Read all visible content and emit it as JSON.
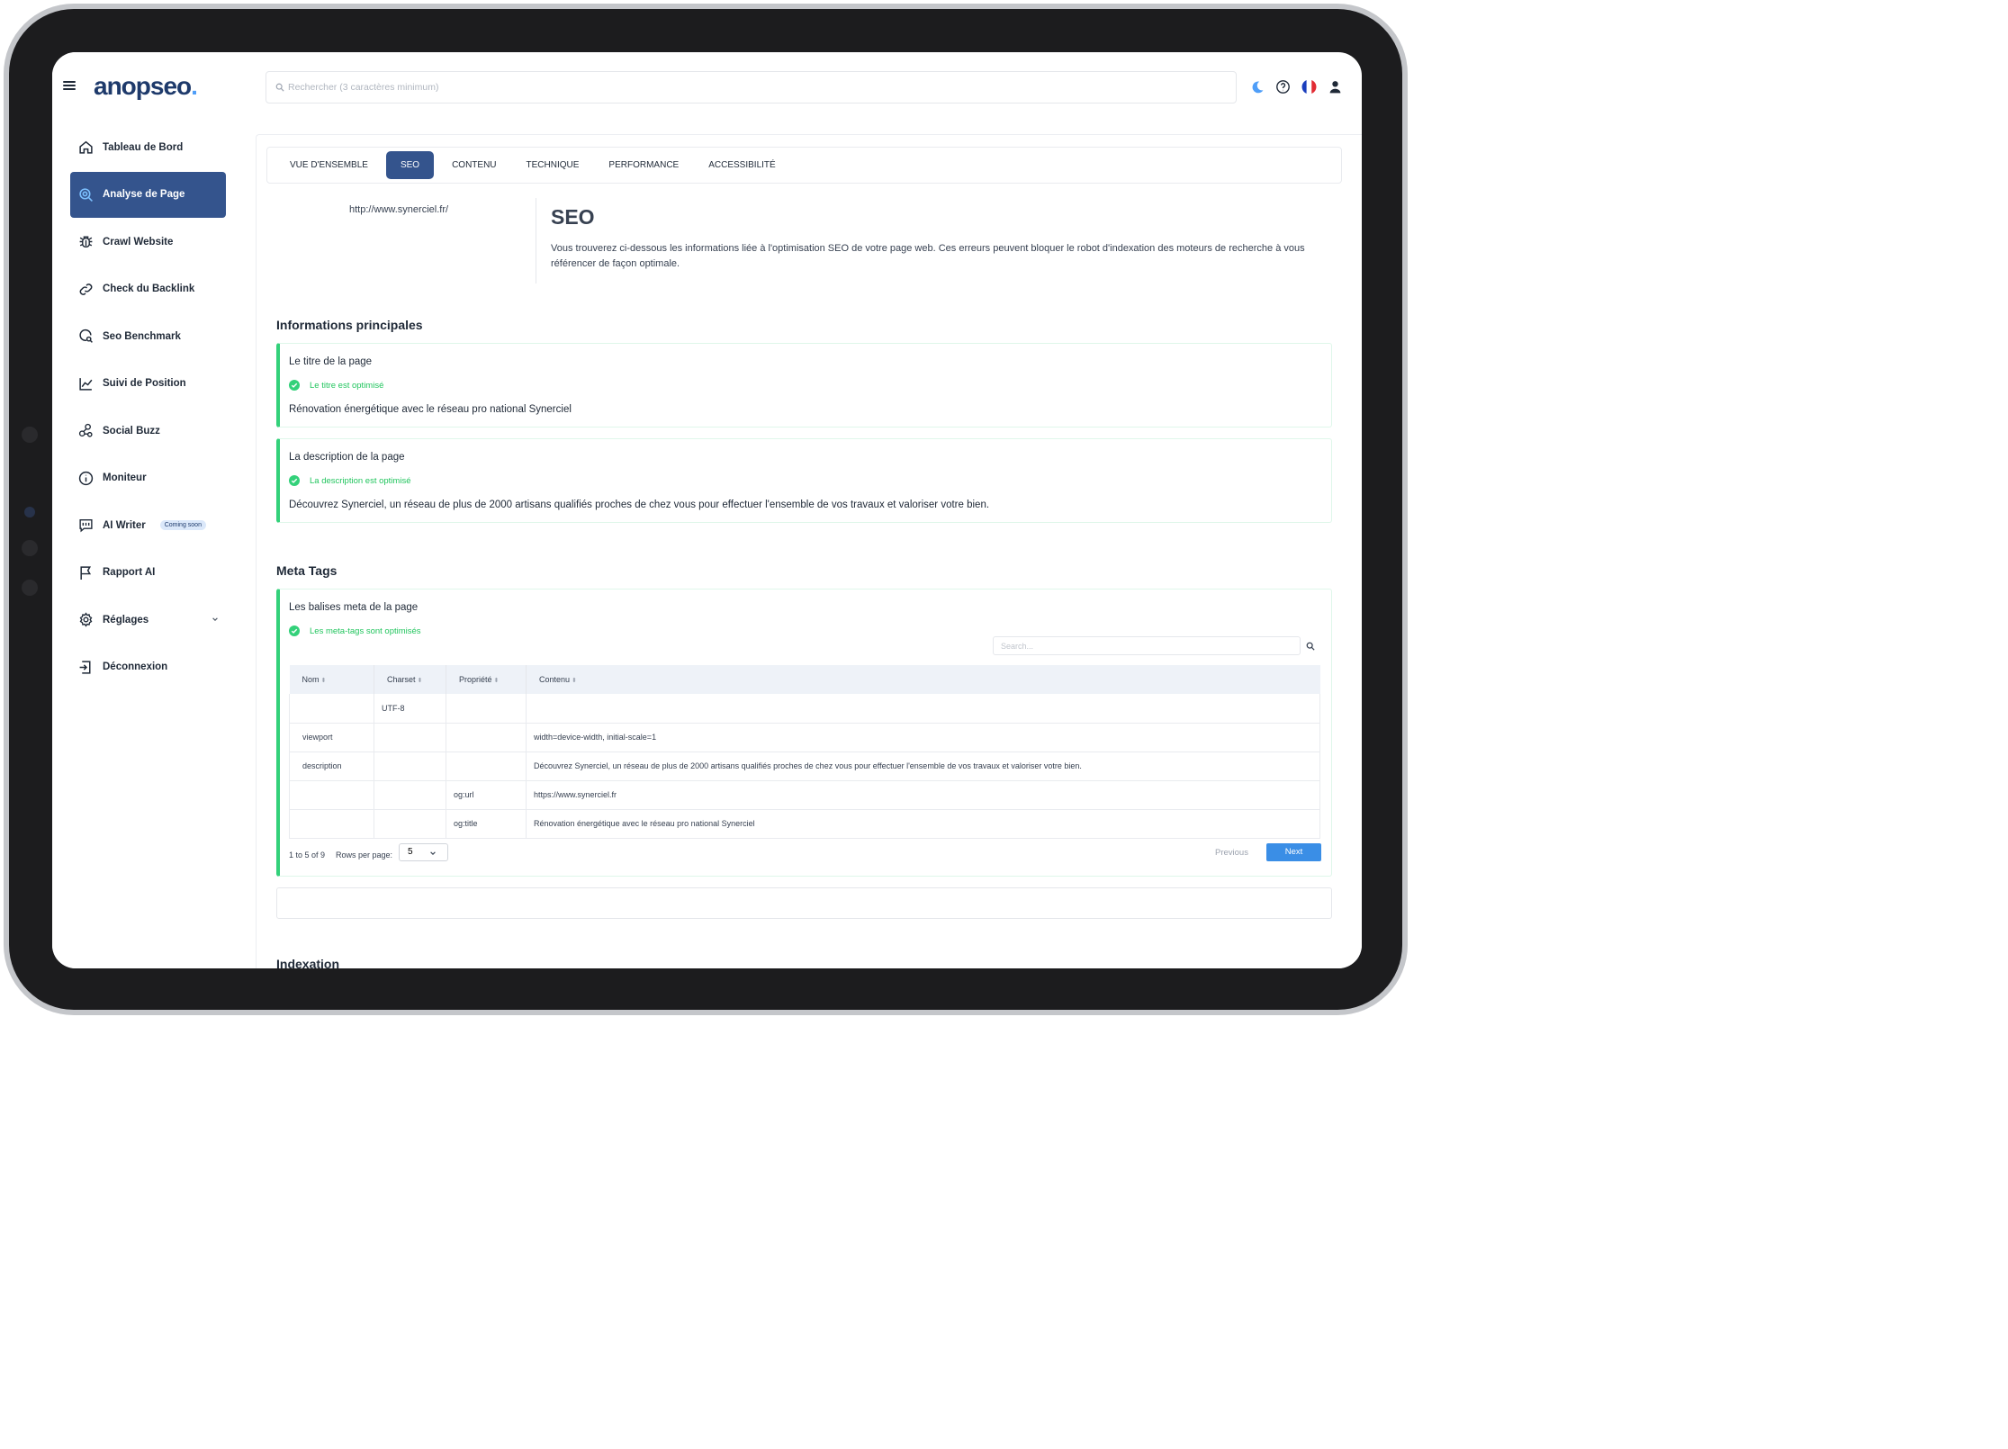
{
  "brand": {
    "name": "anopseo",
    "dot": "."
  },
  "search": {
    "placeholder": "Rechercher (3 caractères minimum)"
  },
  "topbar_icons": [
    "moon-icon",
    "help-icon",
    "flag-fr-icon",
    "user-icon"
  ],
  "sidebar": {
    "items": [
      {
        "label": "Tableau de Bord",
        "icon": "home-icon"
      },
      {
        "label": "Analyse de Page",
        "icon": "search-page-icon",
        "active": true
      },
      {
        "label": "Crawl Website",
        "icon": "bug-icon"
      },
      {
        "label": "Check du Backlink",
        "icon": "link-icon"
      },
      {
        "label": "Seo Benchmark",
        "icon": "benchmark-icon"
      },
      {
        "label": "Suivi de Position",
        "icon": "chart-line-icon"
      },
      {
        "label": "Social Buzz",
        "icon": "share-icon"
      },
      {
        "label": "Moniteur",
        "icon": "info-icon"
      },
      {
        "label": "AI Writer",
        "icon": "chat-icon",
        "badge": "Coming soon"
      },
      {
        "label": "Rapport AI",
        "icon": "flag-icon"
      },
      {
        "label": "Réglages",
        "icon": "gear-icon"
      },
      {
        "label": "Déconnexion",
        "icon": "logout-icon"
      }
    ]
  },
  "tabs": [
    "VUE D'ENSEMBLE",
    "SEO",
    "CONTENU",
    "TECHNIQUE",
    "PERFORMANCE",
    "ACCESSIBILITÉ"
  ],
  "active_tab": "SEO",
  "page": {
    "url": "http://www.synerciel.fr/",
    "title": "SEO",
    "intro": "Vous trouverez ci-dessous les informations liée à l'optimisation SEO de votre page web. Ces erreurs peuvent bloquer le robot d'indexation des moteurs de recherche à vous référencer de façon optimale."
  },
  "sections": {
    "main_info": "Informations principales",
    "meta_tags": "Meta Tags",
    "indexation": "Indexation"
  },
  "cards": {
    "title": {
      "heading": "Le titre de la page",
      "status": "Le titre est optimisé",
      "value": "Rénovation énergétique avec le réseau pro national Synerciel"
    },
    "description": {
      "heading": "La description de la page",
      "status": "La description est optimisé",
      "value": "Découvrez Synerciel, un réseau de plus de 2000 artisans qualifiés proches de chez vous pour effectuer l'ensemble de vos travaux et valoriser votre bien."
    },
    "meta": {
      "heading": "Les balises meta de la page",
      "status": "Les meta-tags sont optimisés"
    }
  },
  "meta_table": {
    "search_placeholder": "Search...",
    "headers": [
      "Nom",
      "Charset",
      "Propriété",
      "Contenu"
    ],
    "rows": [
      [
        "",
        "UTF-8",
        "",
        ""
      ],
      [
        "viewport",
        "",
        "",
        "width=device-width, initial-scale=1"
      ],
      [
        "description",
        "",
        "",
        "Découvrez Synerciel, un réseau de plus de 2000 artisans qualifiés proches de chez vous pour effectuer l'ensemble de vos travaux et valoriser votre bien."
      ],
      [
        "",
        "",
        "og:url",
        "https://www.synerciel.fr"
      ],
      [
        "",
        "",
        "og:title",
        "Rénovation énergétique avec le réseau pro national Synerciel"
      ]
    ],
    "range": "1 to 5 of 9",
    "rows_per_page_label": "Rows per page:",
    "rows_per_page": "5",
    "previous": "Previous",
    "next": "Next"
  },
  "colors": {
    "primary": "#34548d",
    "success": "#33d17a",
    "accent": "#3a8ee6",
    "moon": "#4f9ef8"
  }
}
